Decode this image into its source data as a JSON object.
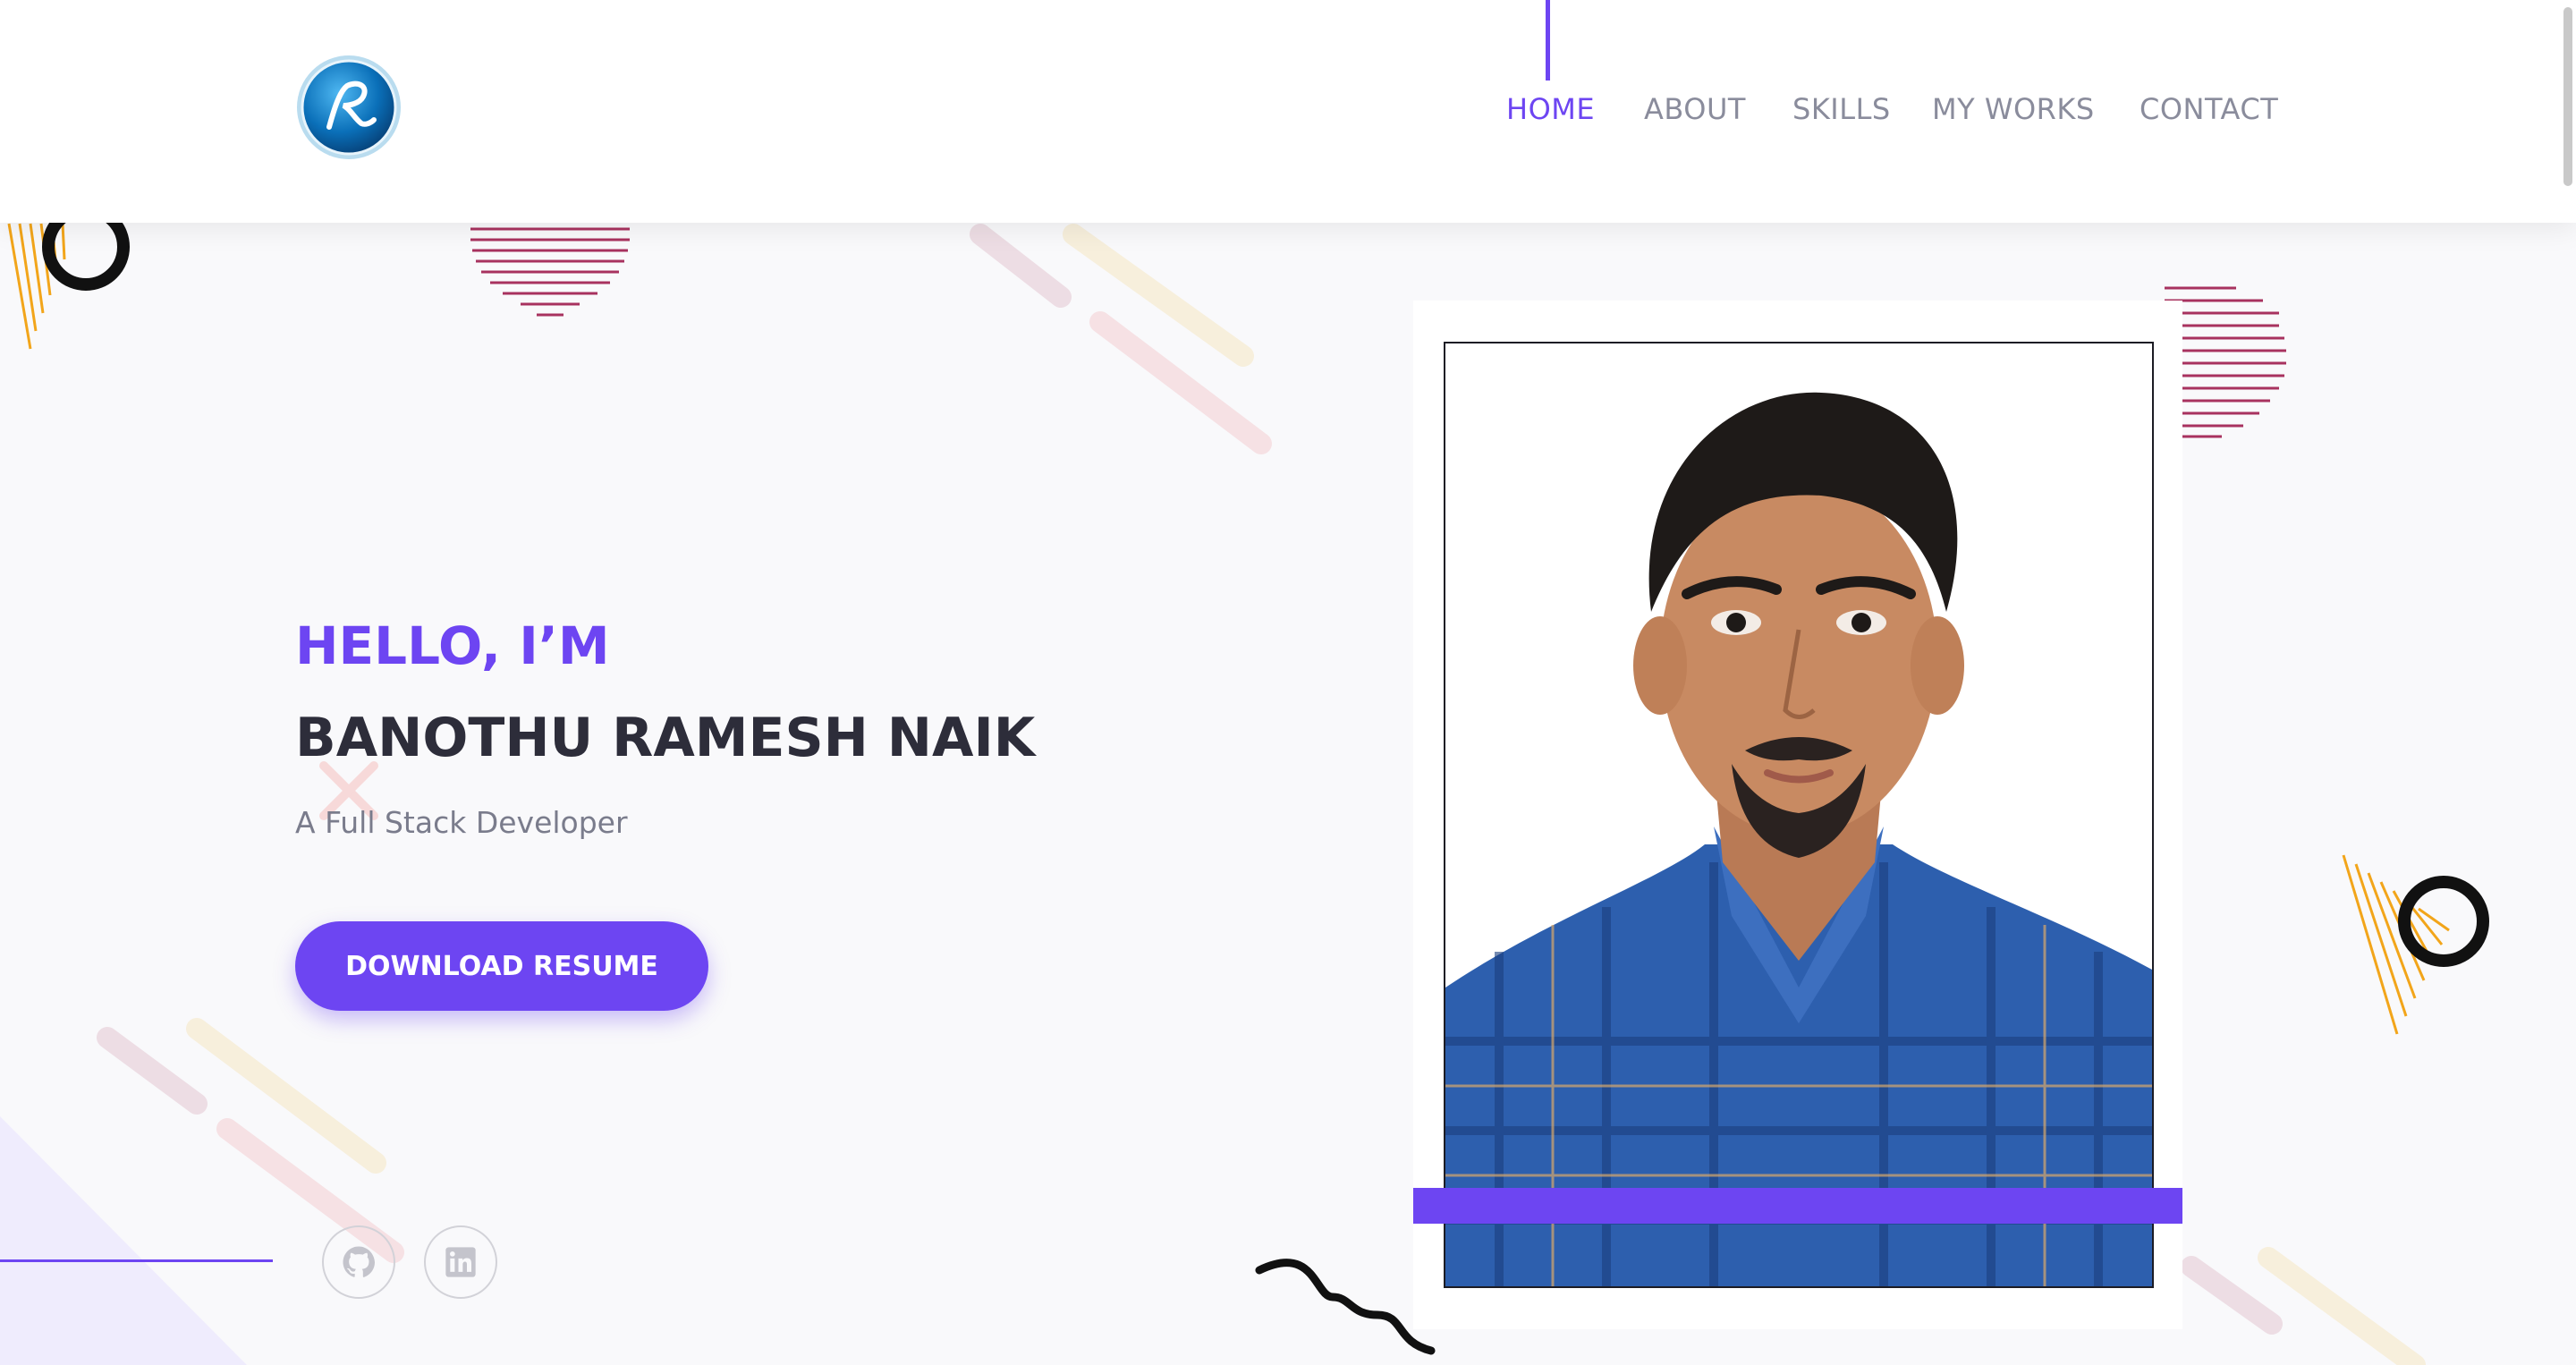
{
  "nav": {
    "items": [
      {
        "label": "HOME",
        "active": true
      },
      {
        "label": "ABOUT",
        "active": false
      },
      {
        "label": "SKILLS",
        "active": false
      },
      {
        "label": "MY WORKS",
        "active": false
      },
      {
        "label": "CONTACT",
        "active": false
      }
    ]
  },
  "hero": {
    "greeting": "HELLO, I’M",
    "name": "BANOTHU RAMESH NAIK",
    "subtitle": "A Full Stack Developer",
    "download_label": "DOWNLOAD RESUME"
  },
  "social": {
    "icons": [
      "github-icon",
      "linkedin-icon"
    ]
  },
  "colors": {
    "accent": "#6d45f2",
    "heading": "#2d2d3a",
    "muted": "#8a8c9c",
    "deco_pink": "#a8325f",
    "deco_orange": "#f2a51a"
  }
}
